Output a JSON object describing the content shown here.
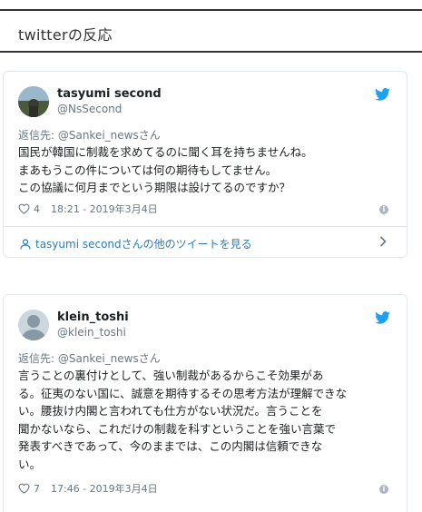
{
  "section": {
    "title": "twitterの反応"
  },
  "tweets": [
    {
      "name": "tasyumi second",
      "handle": "@NsSecond",
      "reply_prefix": "返信先: ",
      "reply_to": "@Sankei_newsさん",
      "text": "国民が韓国に制裁を求めてるのに聞く耳を持ちませんね。\nまあもうこの件については何の期待もしてません。\nこの協議に何月までという期限は設けてるのですか？",
      "likes": "4",
      "timestamp": "18:21 - 2019年3月4日",
      "more_link": "tasyumi secondさんの他のツイートを見る",
      "avatar_icon": "user-photo-avatar"
    },
    {
      "name": "klein_toshi",
      "handle": "@klein_toshi",
      "reply_prefix": "返信先: ",
      "reply_to": "@Sankei_newsさん",
      "text": "言うことの裏付けとして、強い制裁があるからこそ効果があ\nる。征夷のない国に、誠意を期待するその思考方法が理解できな\nい。腰抜け内閣と言われても仕方がない状況だ。言うことを\n聞かないなら、これだけの制裁を科すということを強い言葉で\n発表すべきであって、今のままでは、この内閣は信頼できな\nい。",
      "likes": "7",
      "timestamp": "17:46 - 2019年3月4日",
      "avatar_icon": "default-avatar"
    }
  ],
  "colors": {
    "twitter_blue": "#1da1f2",
    "link": "#2b7bb9",
    "muted": "#697882",
    "border": "#e1e8ed"
  }
}
